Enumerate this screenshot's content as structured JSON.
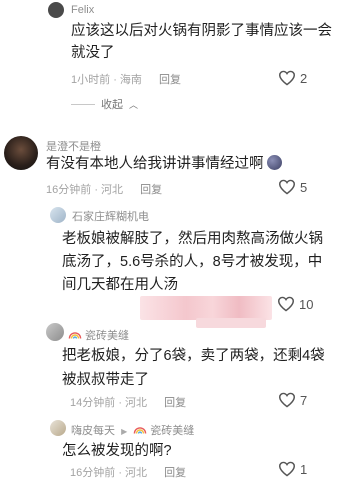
{
  "comments": [
    {
      "user": "Felix",
      "text": "应该这以后对火锅有阴影了事情应该一会就没了",
      "time": "1小时前",
      "location": "海南",
      "reply_label": "回复",
      "likes": "2",
      "collapse": "收起"
    },
    {
      "user": "是澄不是橙",
      "text": "有没有本地人给我讲讲事情经过啊",
      "time": "16分钟前",
      "location": "河北",
      "reply_label": "回复",
      "likes": "5"
    },
    {
      "user": "石家庄辉糊机电",
      "text": "老板娘被解肢了，然后用肉熬高汤做火锅底汤了，5.6号杀的人，8号才被发现，中间几天都在用人汤",
      "likes": "10"
    },
    {
      "user": "瓷砖美缝",
      "text": "把老板娘，分了6袋，卖了两袋，还剩4袋被叔叔带走了",
      "time": "14分钟前",
      "location": "河北",
      "reply_label": "回复",
      "likes": "7"
    },
    {
      "user": "嗨皮每天",
      "reply_to": "瓷砖美缝",
      "text": "怎么被发现的啊?",
      "time": "16分钟前",
      "location": "河北",
      "reply_label": "回复",
      "likes": "1"
    }
  ],
  "separator": "·",
  "reply_arrow": "▶",
  "colors": {
    "blur_pink": "#f4c7cd",
    "blur_light": "#fbe3e6"
  }
}
